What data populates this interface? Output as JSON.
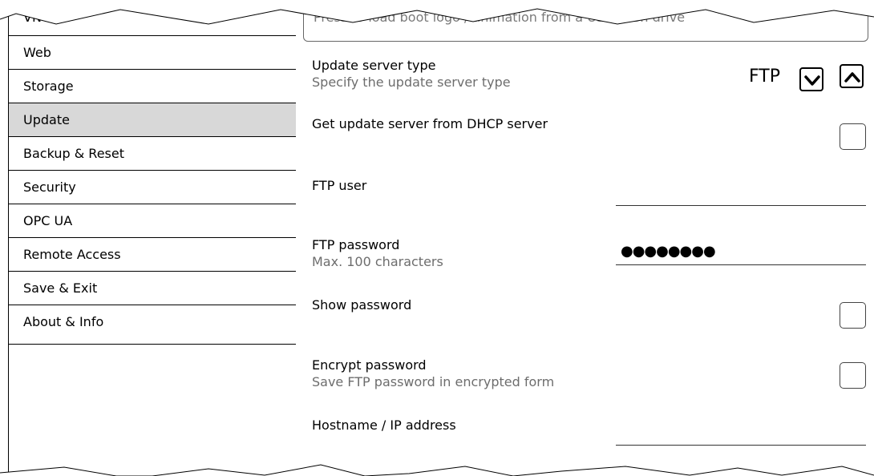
{
  "sidebar": {
    "items": [
      {
        "label": "VNC"
      },
      {
        "label": "Web"
      },
      {
        "label": "Storage"
      },
      {
        "label": "Update"
      },
      {
        "label": "Backup & Reset"
      },
      {
        "label": "Security"
      },
      {
        "label": "OPC UA"
      },
      {
        "label": "Remote Access"
      },
      {
        "label": "Save & Exit"
      },
      {
        "label": "About & Info"
      }
    ],
    "active": "Update"
  },
  "main": {
    "boot_logo_button": "Press to load boot logo / animation from a USB flash drive",
    "update_server_type": {
      "label": "Update server type",
      "description": "Specify the update server type",
      "value": "FTP"
    },
    "dhcp": {
      "label": "Get update server from DHCP server",
      "checked": false
    },
    "ftp_user": {
      "label": "FTP user",
      "value": ""
    },
    "ftp_password": {
      "label": "FTP password",
      "description": "Max. 100 characters",
      "value": "●●●●●●●●"
    },
    "show_password": {
      "label": "Show password",
      "checked": false
    },
    "encrypt_password": {
      "label": "Encrypt password",
      "description": "Save FTP password in encrypted form",
      "checked": false
    },
    "hostname": {
      "label": "Hostname / IP address",
      "value": ""
    }
  },
  "icons": {
    "down": "chevron-down-icon",
    "up": "chevron-up-icon"
  }
}
